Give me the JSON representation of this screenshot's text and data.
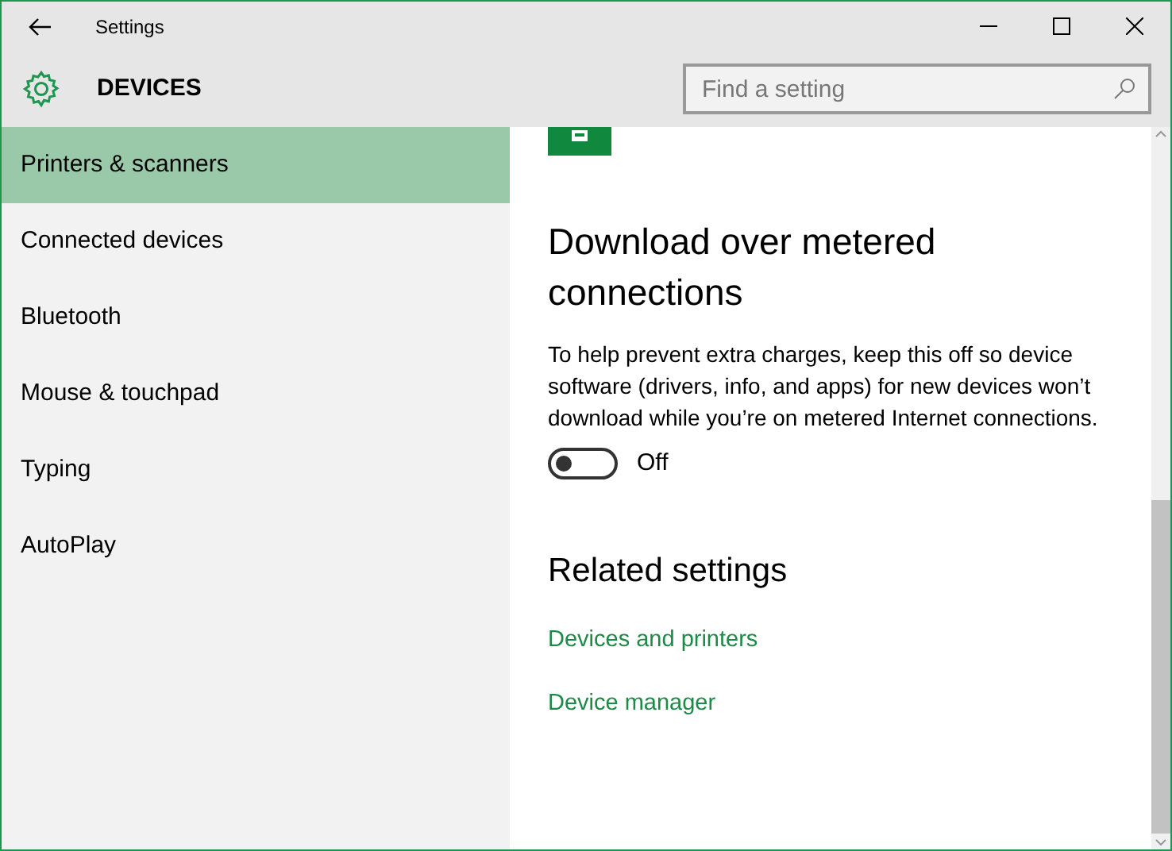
{
  "window": {
    "title": "Settings"
  },
  "header": {
    "title": "DEVICES",
    "search": {
      "placeholder": "Find a setting"
    }
  },
  "sidebar": {
    "items": [
      {
        "label": "Printers & scanners",
        "selected": true
      },
      {
        "label": "Connected devices",
        "selected": false
      },
      {
        "label": "Bluetooth",
        "selected": false
      },
      {
        "label": "Mouse & touchpad",
        "selected": false
      },
      {
        "label": "Typing",
        "selected": false
      },
      {
        "label": "AutoPlay",
        "selected": false
      }
    ]
  },
  "content": {
    "section_title": "Download over metered connections",
    "description": "To help prevent extra charges, keep this off so device software (drivers, info, and apps) for new devices won’t download while you’re on metered Internet connections.",
    "toggle": {
      "on": false,
      "label": "Off"
    },
    "related_title": "Related settings",
    "links": [
      "Devices and printers",
      "Device manager"
    ]
  }
}
